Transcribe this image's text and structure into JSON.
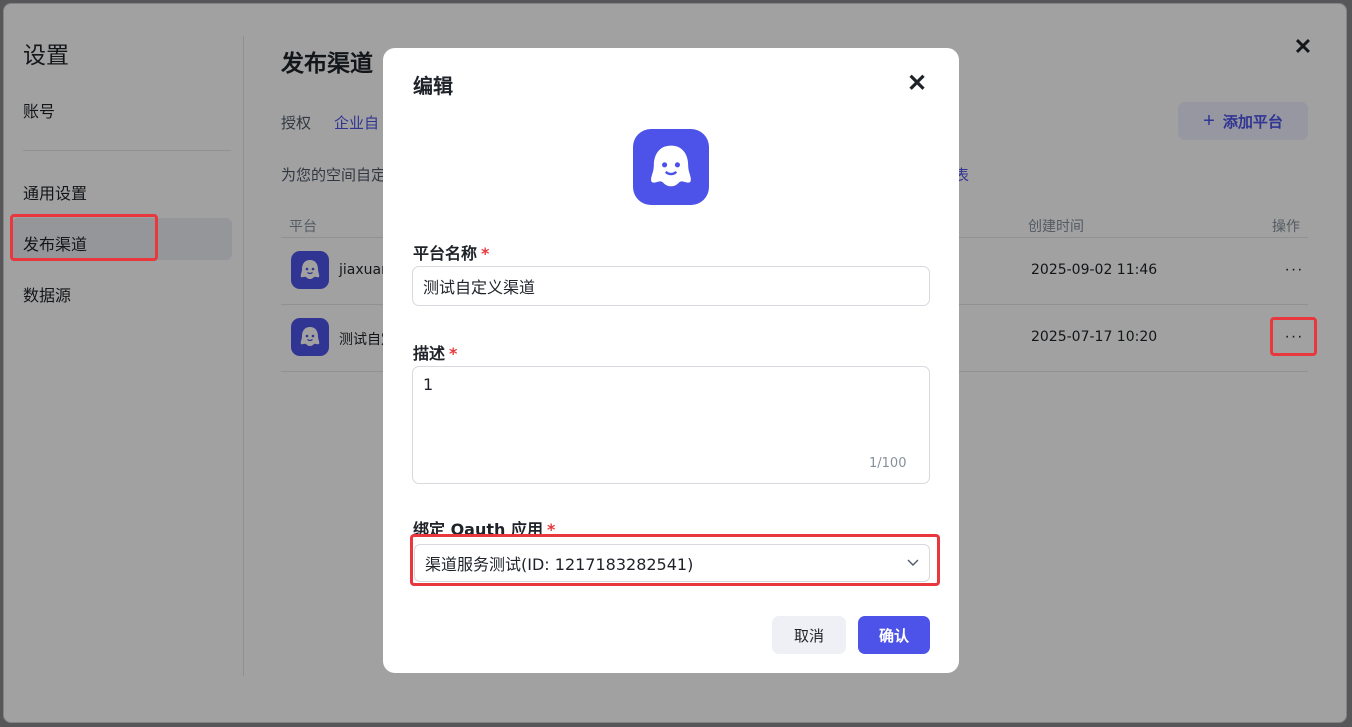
{
  "window": {
    "close_icon": "close-icon"
  },
  "sidebar": {
    "title": "设置",
    "items": [
      {
        "label": "账号"
      },
      {
        "label": "通用设置"
      },
      {
        "label": "发布渠道"
      },
      {
        "label": "数据源"
      }
    ],
    "active_item": "发布渠道"
  },
  "main": {
    "title": "发布渠道",
    "tabs": [
      {
        "label": "授权"
      },
      {
        "label": "企业自"
      }
    ],
    "description": "为您的空间自定",
    "description_link": "表",
    "add_button": {
      "icon": "plus-icon",
      "label": "添加平台"
    },
    "table": {
      "headers": {
        "platform": "平台",
        "created": "创建时间",
        "actions": "操作"
      },
      "rows": [
        {
          "name": "jiaxuan",
          "created": "2025-09-02 11:46",
          "action": "···"
        },
        {
          "name": "测试自定",
          "created": "2025-07-17 10:20",
          "action": "···"
        }
      ]
    }
  },
  "modal": {
    "title": "编辑",
    "close_icon": "close-icon",
    "logo_icon": "ghost-mascot-icon",
    "fields": {
      "name": {
        "label": "平台名称",
        "required": "*",
        "value": "测试自定义渠道"
      },
      "description": {
        "label": "描述",
        "required": "*",
        "value": "1",
        "counter": "1/100"
      },
      "oauth": {
        "label": "绑定 Oauth 应用",
        "required": "*",
        "value": "渠道服务测试(ID: 1217183282541)"
      }
    },
    "buttons": {
      "cancel": "取消",
      "confirm": "确认"
    }
  },
  "colors": {
    "accent": "#4d53e8",
    "highlight": "#e8383d",
    "overlay": "rgba(0,0,0,0.37)"
  }
}
